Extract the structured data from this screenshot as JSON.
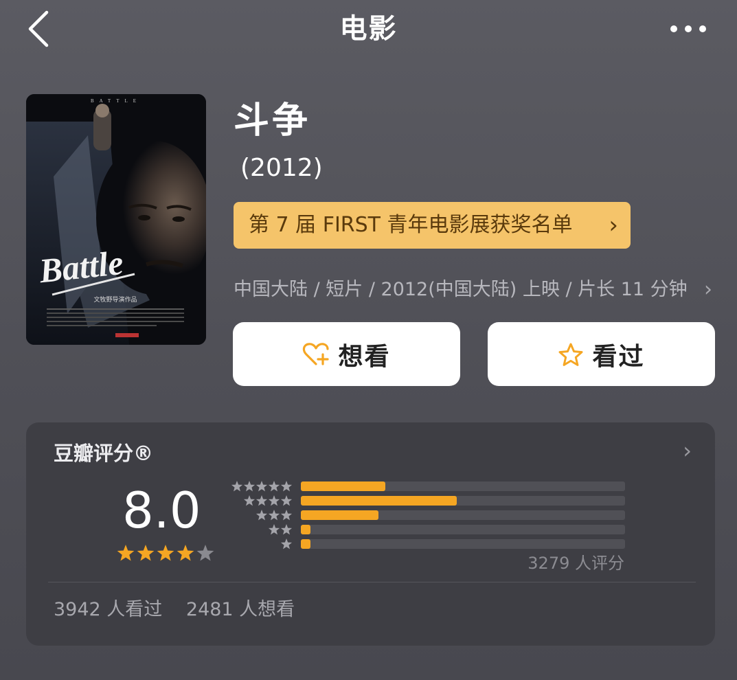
{
  "nav": {
    "title": "电影",
    "back_icon": "chevron-left-icon",
    "more_icon": "more-dots-icon"
  },
  "poster": {
    "title_text": "Battle",
    "top_text": "BATTLE",
    "director_credit": "文牧野导演作品"
  },
  "movie": {
    "title": "斗争",
    "year": "(2012)",
    "award": "第 7 届 FIRST 青年电影展获奖名单",
    "meta": "中国大陆 / 短片 / 2012(中国大陆) 上映 / 片长 11 分钟"
  },
  "actions": {
    "want_label": "想看",
    "want_icon": "heart-plus-icon",
    "seen_label": "看过",
    "seen_icon": "star-outline-icon"
  },
  "rating": {
    "title": "豆瓣评分®",
    "score": "8.0",
    "star_level": 4,
    "distribution": [
      {
        "stars": 5,
        "fraction": 0.26
      },
      {
        "stars": 4,
        "fraction": 0.48
      },
      {
        "stars": 3,
        "fraction": 0.24
      },
      {
        "stars": 2,
        "fraction": 0.03
      },
      {
        "stars": 1,
        "fraction": 0.03
      }
    ],
    "count_text": "3279 人评分",
    "seen_text": "3942 人看过",
    "want_text": "2481 人想看"
  },
  "colors": {
    "accent": "#f5a623",
    "award_bg": "#f5c46a",
    "card_bg": "#3e3e44",
    "page_bg": "#55555c"
  }
}
